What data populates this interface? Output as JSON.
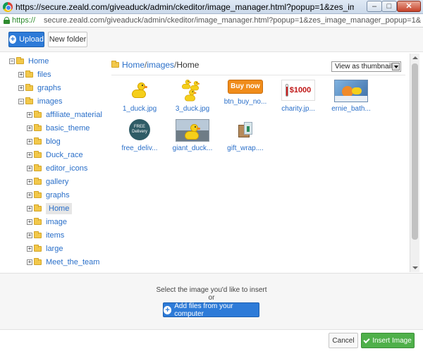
{
  "window": {
    "title": "https://secure.zeald.com/giveaduck/admin/ckeditor/image_manager.html?popup=1&zes_image_manager_popup=1...",
    "min_glyph": "–",
    "max_glyph": "□",
    "close_glyph": "✕"
  },
  "address": {
    "scheme": "https://",
    "rest": "secure.zeald.com/giveaduck/admin/ckeditor/image_manager.html?popup=1&zes_image_manager_popup=1&restrict_images=&toolbarset=&"
  },
  "toolbar": {
    "upload_label": "Upload",
    "new_folder_label": "New folder"
  },
  "tree": {
    "root": "Home",
    "items": [
      {
        "label": "Home",
        "expander": "−"
      },
      {
        "label": "files",
        "expander": "+"
      },
      {
        "label": "graphs",
        "expander": "+"
      },
      {
        "label": "images",
        "expander": "−"
      },
      {
        "label": "affiliate_materials",
        "expander": "+"
      },
      {
        "label": "basic_theme",
        "expander": "+"
      },
      {
        "label": "blog",
        "expander": "+"
      },
      {
        "label": "Duck_race",
        "expander": "+"
      },
      {
        "label": "editor_icons",
        "expander": "+"
      },
      {
        "label": "gallery",
        "expander": "+"
      },
      {
        "label": "graphs",
        "expander": "+"
      },
      {
        "label": "Home",
        "expander": "+"
      },
      {
        "label": "image",
        "expander": "+"
      },
      {
        "label": "items",
        "expander": "+"
      },
      {
        "label": "large",
        "expander": "+"
      },
      {
        "label": "Meet_the_team",
        "expander": "+"
      }
    ],
    "selected": "Home"
  },
  "breadcrumb": {
    "home": "Home",
    "sep": "/",
    "images": "images",
    "current": "Home"
  },
  "view_select": {
    "value": "View as thumbnails"
  },
  "thumbnails": [
    {
      "caption": "1_duck.jpg"
    },
    {
      "caption": "3_duck.jpg"
    },
    {
      "caption": "btn_buy_no...",
      "image_text": "Buy now"
    },
    {
      "caption": "charity.jp...",
      "image_text": "$1000"
    },
    {
      "caption": "ernie_bath..."
    },
    {
      "caption": "free_deliv...",
      "image_text": "FREE Delivery"
    },
    {
      "caption": "giant_duck..."
    },
    {
      "caption": "gift_wrap...."
    }
  ],
  "dropzone": {
    "prompt": "Select the image you'd like to insert",
    "or": "or",
    "add_files_label": "Add files from your computer"
  },
  "footer": {
    "cancel_label": "Cancel",
    "insert_label": "Insert Image"
  },
  "colors": {
    "primary_blue": "#2d7bd8",
    "link_blue": "#2a6fc9",
    "success_green": "#4fb04a"
  }
}
